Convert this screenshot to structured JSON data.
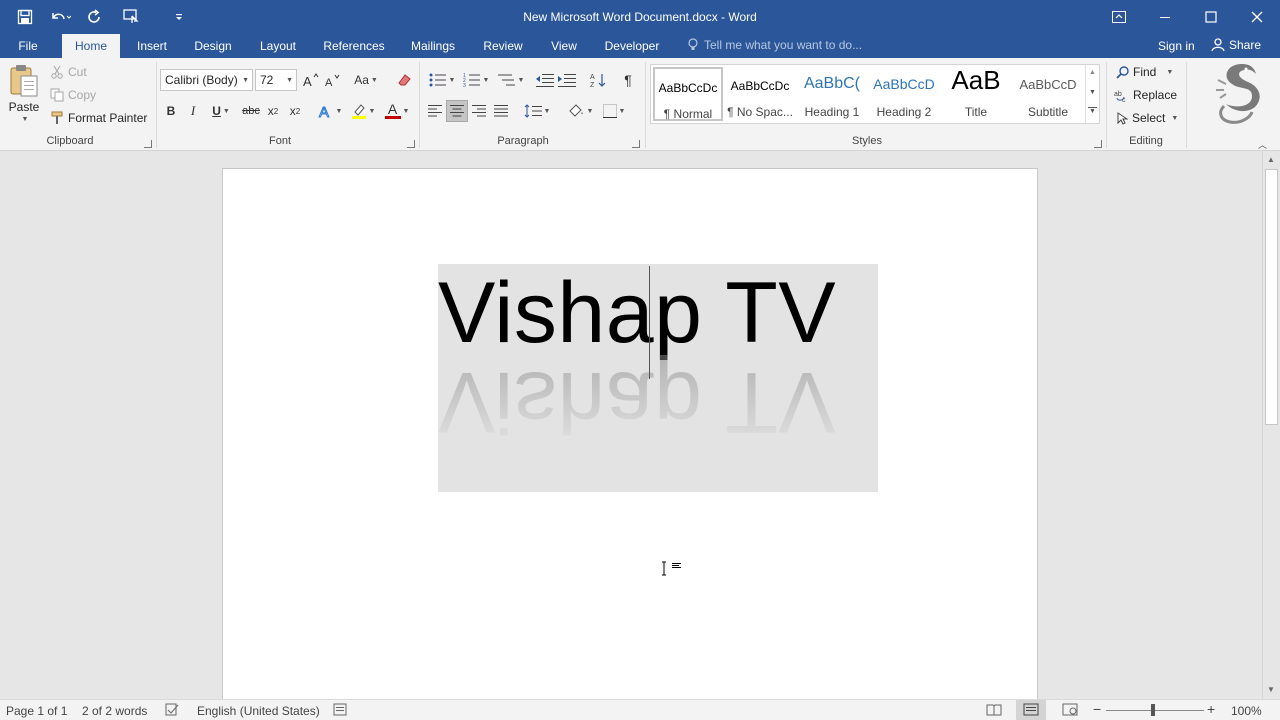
{
  "window": {
    "title": "New Microsoft Word Document.docx - Word"
  },
  "qat": {
    "icons": [
      "save-icon",
      "undo-icon",
      "redo-icon",
      "touch-mode-icon",
      "customize-icon"
    ]
  },
  "tabs": {
    "file": "File",
    "home": "Home",
    "insert": "Insert",
    "design": "Design",
    "layout": "Layout",
    "references": "References",
    "mailings": "Mailings",
    "review": "Review",
    "view": "View",
    "developer": "Developer"
  },
  "tellme": {
    "placeholder": "Tell me what you want to do..."
  },
  "account": {
    "signin": "Sign in",
    "share": "Share"
  },
  "clipboard": {
    "paste": "Paste",
    "cut": "Cut",
    "copy": "Copy",
    "format_painter": "Format Painter",
    "label": "Clipboard"
  },
  "font": {
    "name": "Calibri (Body)",
    "size": "72",
    "change_case": "Aa",
    "bold": "B",
    "italic": "I",
    "underline": "U",
    "strike": "abc",
    "subscript": "x",
    "subscript_mark": "2",
    "superscript": "x",
    "superscript_mark": "2",
    "font_color": "A",
    "label": "Font"
  },
  "paragraph": {
    "label": "Paragraph"
  },
  "styles": {
    "label": "Styles",
    "items": [
      {
        "sample": "AaBbCcDc",
        "name": "¶ Normal"
      },
      {
        "sample": "AaBbCcDc",
        "name": "¶ No Spac..."
      },
      {
        "sample": "AaBbC(",
        "name": "Heading 1"
      },
      {
        "sample": "AaBbCcD",
        "name": "Heading 2"
      },
      {
        "sample": "AaB",
        "name": "Title"
      },
      {
        "sample": "AaBbCcD",
        "name": "Subtitle"
      }
    ]
  },
  "editing": {
    "find": "Find",
    "replace": "Replace",
    "select": "Select",
    "label": "Editing"
  },
  "document": {
    "text": "Vishap TV"
  },
  "status": {
    "page": "Page 1 of 1",
    "words": "2 of 2 words",
    "language": "English (United States)",
    "zoom": "100%"
  },
  "colors": {
    "brand": "#2b579a",
    "ribbon": "#f3f3f3",
    "highlight": "#ffff00",
    "font_color": "#c00000"
  }
}
